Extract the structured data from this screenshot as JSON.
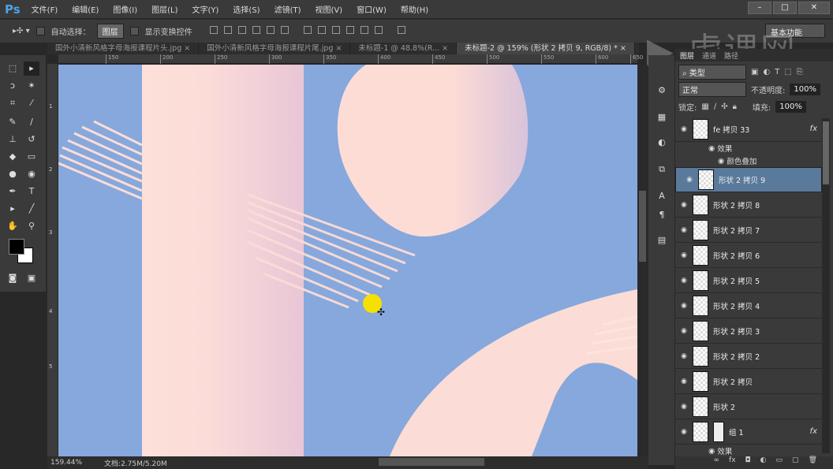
{
  "app": {
    "logo": "Ps",
    "menus": [
      "文件(F)",
      "编辑(E)",
      "图像(I)",
      "图层(L)",
      "文字(Y)",
      "选择(S)",
      "滤镜(T)",
      "视图(V)",
      "窗口(W)",
      "帮助(H)"
    ],
    "window_buttons": [
      "–",
      "□",
      "✕"
    ]
  },
  "options": {
    "auto_select_label": "自动选择：",
    "auto_select_value": "图层",
    "show_transform_label": "显示变换控件",
    "workspace": "基本功能"
  },
  "tabs": [
    {
      "label": "国外小清新风格字母海报课程片头.jpg ×"
    },
    {
      "label": "国外小清新风格字母海报课程片尾.jpg ×"
    },
    {
      "label": "未标题-1 @ 48.8%(R... ×"
    },
    {
      "label": "未标题-2 @ 159% (形状 2 拷贝 9, RGB/8) * ×",
      "active": true
    }
  ],
  "ruler_top": [
    "150",
    "200",
    "250",
    "300",
    "350",
    "400",
    "450",
    "500",
    "550",
    "600",
    "650"
  ],
  "ruler_left": [
    "1",
    "2",
    "3",
    "4",
    "5"
  ],
  "status": {
    "zoom": "159.44%",
    "doc": "文档:2.75M/5.20M"
  },
  "watermark": "虎课网",
  "panel": {
    "tabs": [
      "图层",
      "通道",
      "路径"
    ],
    "filter": "类型",
    "blend_mode": "正常",
    "opacity_label": "不透明度:",
    "opacity": "100%",
    "lock_label": "锁定:",
    "fill_label": "填充:",
    "fill": "100%",
    "layers": [
      {
        "name": "fe 拷贝 33",
        "fx": "fx"
      },
      {
        "name": "形状 2 拷贝 9",
        "selected": true
      },
      {
        "name": "形状 2 拷贝 8"
      },
      {
        "name": "形状 2 拷贝 7"
      },
      {
        "name": "形状 2 拷贝 6"
      },
      {
        "name": "形状 2 拷贝 5"
      },
      {
        "name": "形状 2 拷贝 4"
      },
      {
        "name": "形状 2 拷贝 3"
      },
      {
        "name": "形状 2 拷贝 2"
      },
      {
        "name": "形状 2 拷贝"
      },
      {
        "name": "形状 2"
      },
      {
        "name": "组 1",
        "fx": "fx"
      }
    ],
    "effects_label": "效果",
    "color_overlay_label": "颜色叠加",
    "effects_label_2": "效果"
  },
  "colors": {
    "canvas_bg": "#86a8dc",
    "shape_pink": "#fde0da",
    "selected_layer": "#5a7a9c",
    "cursor_highlight": "#f5e000"
  }
}
